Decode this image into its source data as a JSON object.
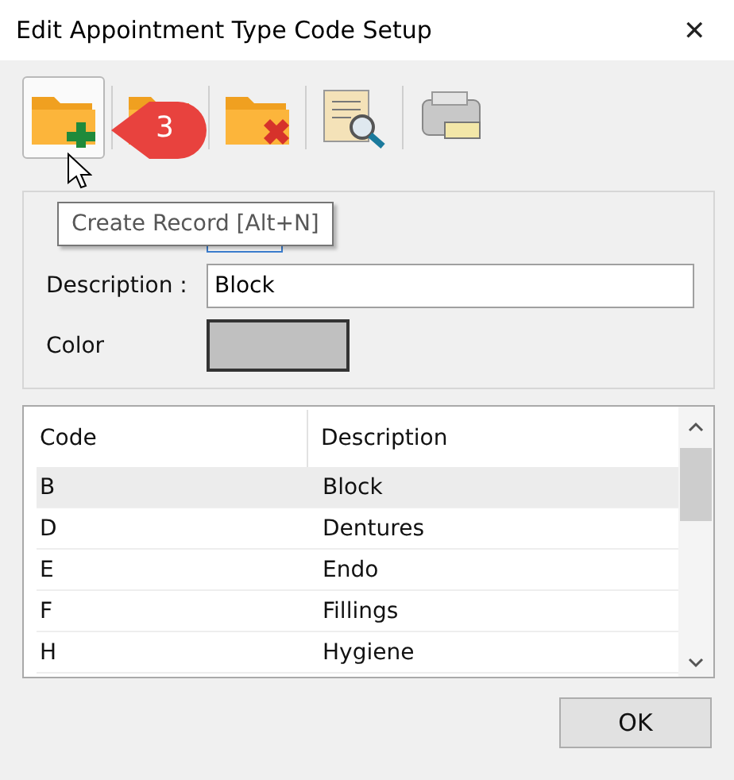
{
  "window": {
    "title": "Edit Appointment Type Code Setup",
    "close": "✕"
  },
  "toolbar": {
    "buttons": [
      {
        "kind": "add",
        "hovered": true
      },
      {
        "kind": "edit",
        "hovered": false
      },
      {
        "kind": "delete",
        "hovered": false
      },
      {
        "kind": "preview",
        "hovered": false
      },
      {
        "kind": "print",
        "hovered": false
      }
    ]
  },
  "callout": {
    "label": "3"
  },
  "tooltip": {
    "text": "Create Record [Alt+N]"
  },
  "form": {
    "description_label": "Description :",
    "description_value": "Block",
    "color_label": "Color",
    "color": "#c0c0c0"
  },
  "table": {
    "columns": [
      "Code",
      "Description"
    ],
    "rows": [
      {
        "code": "B",
        "description": "Block",
        "selected": true
      },
      {
        "code": "D",
        "description": "Dentures",
        "selected": false
      },
      {
        "code": "E",
        "description": "Endo",
        "selected": false
      },
      {
        "code": "F",
        "description": "Fillings",
        "selected": false
      },
      {
        "code": "H",
        "description": "Hygiene",
        "selected": false
      }
    ]
  },
  "buttons": [
    "OK"
  ]
}
